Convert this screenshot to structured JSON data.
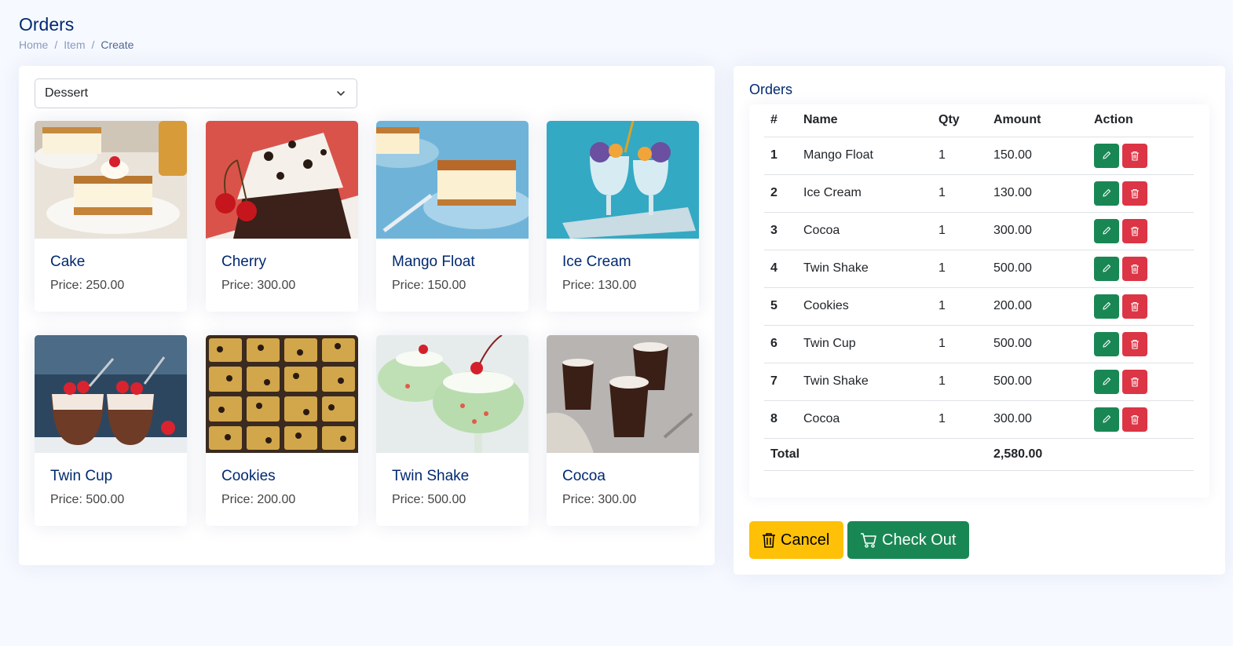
{
  "page": {
    "title": "Orders",
    "breadcrumb": [
      "Home",
      "Item",
      "Create"
    ]
  },
  "category_select": {
    "value": "Dessert"
  },
  "products": [
    {
      "name": "Cake",
      "price": "Price: 250.00",
      "image": "cake-image"
    },
    {
      "name": "Cherry",
      "price": "Price: 300.00",
      "image": "cherry-cake-image"
    },
    {
      "name": "Mango Float",
      "price": "Price: 150.00",
      "image": "mango-float-image"
    },
    {
      "name": "Ice Cream",
      "price": "Price: 130.00",
      "image": "ice-cream-image"
    },
    {
      "name": "Twin Cup",
      "price": "Price: 500.00",
      "image": "twin-cup-image"
    },
    {
      "name": "Cookies",
      "price": "Price: 200.00",
      "image": "cookies-image"
    },
    {
      "name": "Twin Shake",
      "price": "Price: 500.00",
      "image": "twin-shake-image"
    },
    {
      "name": "Cocoa",
      "price": "Price: 300.00",
      "image": "cocoa-image"
    }
  ],
  "orders": {
    "title": "Orders",
    "columns": [
      "#",
      "Name",
      "Qty",
      "Amount",
      "Action"
    ],
    "rows": [
      {
        "num": "1",
        "name": "Mango Float",
        "qty": "1",
        "amount": "150.00"
      },
      {
        "num": "2",
        "name": "Ice Cream",
        "qty": "1",
        "amount": "130.00"
      },
      {
        "num": "3",
        "name": "Cocoa",
        "qty": "1",
        "amount": "300.00"
      },
      {
        "num": "4",
        "name": "Twin Shake",
        "qty": "1",
        "amount": "500.00"
      },
      {
        "num": "5",
        "name": "Cookies",
        "qty": "1",
        "amount": "200.00"
      },
      {
        "num": "6",
        "name": "Twin Cup",
        "qty": "1",
        "amount": "500.00"
      },
      {
        "num": "7",
        "name": "Twin Shake",
        "qty": "1",
        "amount": "500.00"
      },
      {
        "num": "8",
        "name": "Cocoa",
        "qty": "1",
        "amount": "300.00"
      }
    ],
    "total_label": "Total",
    "total_value": "2,580.00"
  },
  "buttons": {
    "cancel": "Cancel",
    "checkout": "Check Out"
  },
  "icons": {
    "edit": "pencil-icon",
    "delete": "trash-icon",
    "cancel": "trash-icon",
    "checkout": "cart-icon",
    "select": "chevron-down-icon"
  },
  "colors": {
    "heading": "#012970",
    "edit_button": "#198754",
    "delete_button": "#dc3545",
    "cancel_button": "#ffc107",
    "checkout_button": "#198754"
  }
}
